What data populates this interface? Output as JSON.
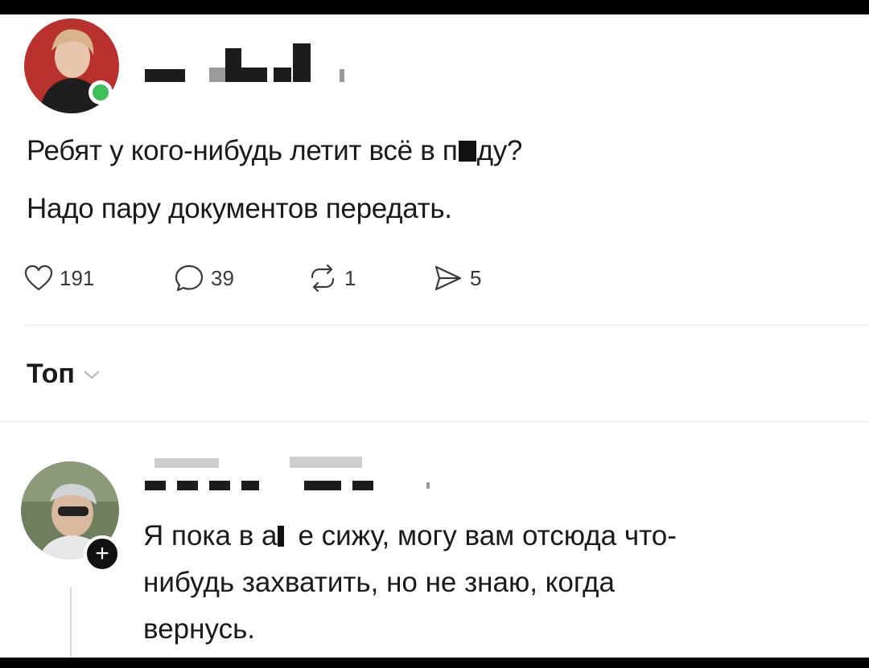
{
  "post": {
    "line1_before": "Ребят у кого-нибудь летит всё в п",
    "line1_after": "ду?",
    "line2": "Надо пару документов передать.",
    "likes": "191",
    "comments": "39",
    "reposts": "1",
    "shares": "5"
  },
  "sort": {
    "label": "Топ"
  },
  "comment": {
    "line1_a": "Я пока в а",
    "line1_b": "е сижу, могу вам отсюда что-",
    "line2": "нибудь захватить, но не знаю, когда",
    "line3": "вернусь.",
    "follow_symbol": "+"
  },
  "colors": {
    "online": "#3ec15a",
    "text": "#1a1a1a",
    "icon": "#3a3a3a"
  },
  "icons": {
    "like": "heart-icon",
    "comment": "speech-bubble-icon",
    "repost": "repost-icon",
    "share": "send-icon",
    "sort": "chevron-down-icon"
  }
}
